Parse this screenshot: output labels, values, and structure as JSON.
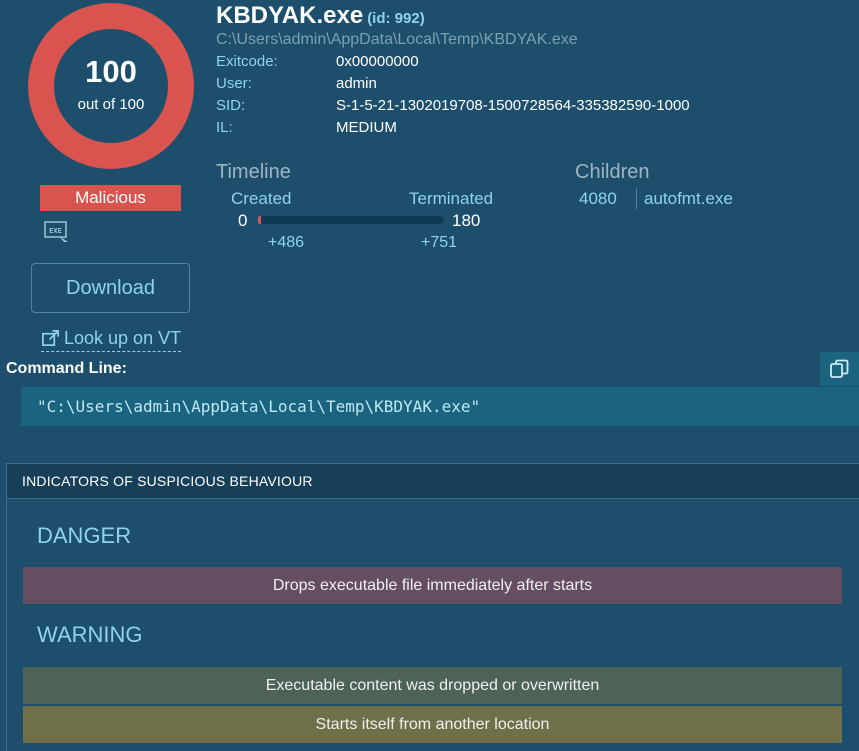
{
  "score": {
    "value": "100",
    "out_of": "out of 100",
    "color": "#d9534f"
  },
  "verdict": {
    "label": "Malicious",
    "color": "#d9534f"
  },
  "file_type_icon": "exe-file-icon",
  "download_label": "Download",
  "vt_link": {
    "icon": "external-link-icon",
    "label": "Look up on VT"
  },
  "process": {
    "name": "KBDYAK.exe",
    "id_text": "(id: 992)",
    "path": "C:\\Users\\admin\\AppData\\Local\\Temp\\KBDYAK.exe",
    "fields": [
      {
        "label": "Exitcode:",
        "value": "0x00000000"
      },
      {
        "label": "User:",
        "value": "admin"
      },
      {
        "label": "SID:",
        "value": "S-1-5-21-1302019708-1500728564-335382590-1000"
      },
      {
        "label": "IL:",
        "value": "MEDIUM"
      }
    ]
  },
  "timeline": {
    "title": "Timeline",
    "created_label": "Created",
    "terminated_label": "Terminated",
    "start": "0",
    "end": "180",
    "created_offset": "+486",
    "terminated_offset": "+751"
  },
  "children": {
    "title": "Children",
    "items": [
      {
        "pid": "4080",
        "name": "autofmt.exe"
      }
    ]
  },
  "command_line": {
    "label": "Command Line:",
    "copy_icon": "copy-icon",
    "value": "\"C:\\Users\\admin\\AppData\\Local\\Temp\\KBDYAK.exe\""
  },
  "indicators": {
    "header": "INDICATORS OF SUSPICIOUS BEHAVIOUR",
    "danger_title": "DANGER",
    "danger_items": [
      "Drops executable file immediately after starts"
    ],
    "warning_title": "WARNING",
    "warning_items": [
      "Executable content was dropped or overwritten",
      "Starts itself from another location"
    ],
    "colors": {
      "danger": "#654d62",
      "warning_a": "#4d6357",
      "warning_b": "#6f7049"
    }
  }
}
